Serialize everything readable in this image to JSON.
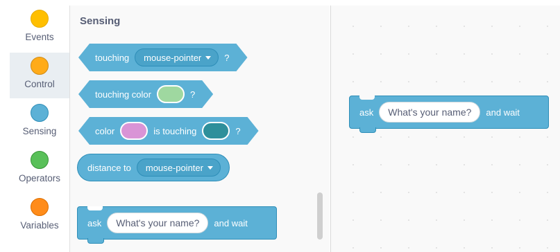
{
  "categories": [
    {
      "label": "Events",
      "color": "#ffbf00",
      "border": "#e6ac00"
    },
    {
      "label": "Control",
      "color": "#ffab19",
      "border": "#cf8b17"
    },
    {
      "label": "Sensing",
      "color": "#5cb1d6",
      "border": "#2e8eb8"
    },
    {
      "label": "Operators",
      "color": "#59c059",
      "border": "#389438"
    },
    {
      "label": "Variables",
      "color": "#ff8c1a",
      "border": "#db6e00"
    }
  ],
  "selected_category": "Control",
  "palette": {
    "title": "Sensing",
    "blocks": {
      "touching": {
        "label": "touching",
        "menu_value": "mouse-pointer",
        "suffix": "?"
      },
      "touching_color": {
        "label": "touching color",
        "color": "#9fd8a0",
        "suffix": "?"
      },
      "color_touching": {
        "label_before": "color",
        "color_a": "#d994d6",
        "label_middle": "is touching",
        "color_b": "#2e8f9b",
        "suffix": "?"
      },
      "distance_to": {
        "label": "distance to",
        "menu_value": "mouse-pointer"
      },
      "ask": {
        "label": "ask",
        "value": "What's your name?",
        "suffix": "and wait"
      }
    }
  },
  "workspace": {
    "ask": {
      "label": "ask",
      "value": "What's your name?",
      "suffix": "and wait"
    }
  },
  "colors": {
    "sensing_block": "#5cb1d6",
    "sensing_block_border": "#2e8eb8",
    "text_secondary": "#575e75"
  }
}
